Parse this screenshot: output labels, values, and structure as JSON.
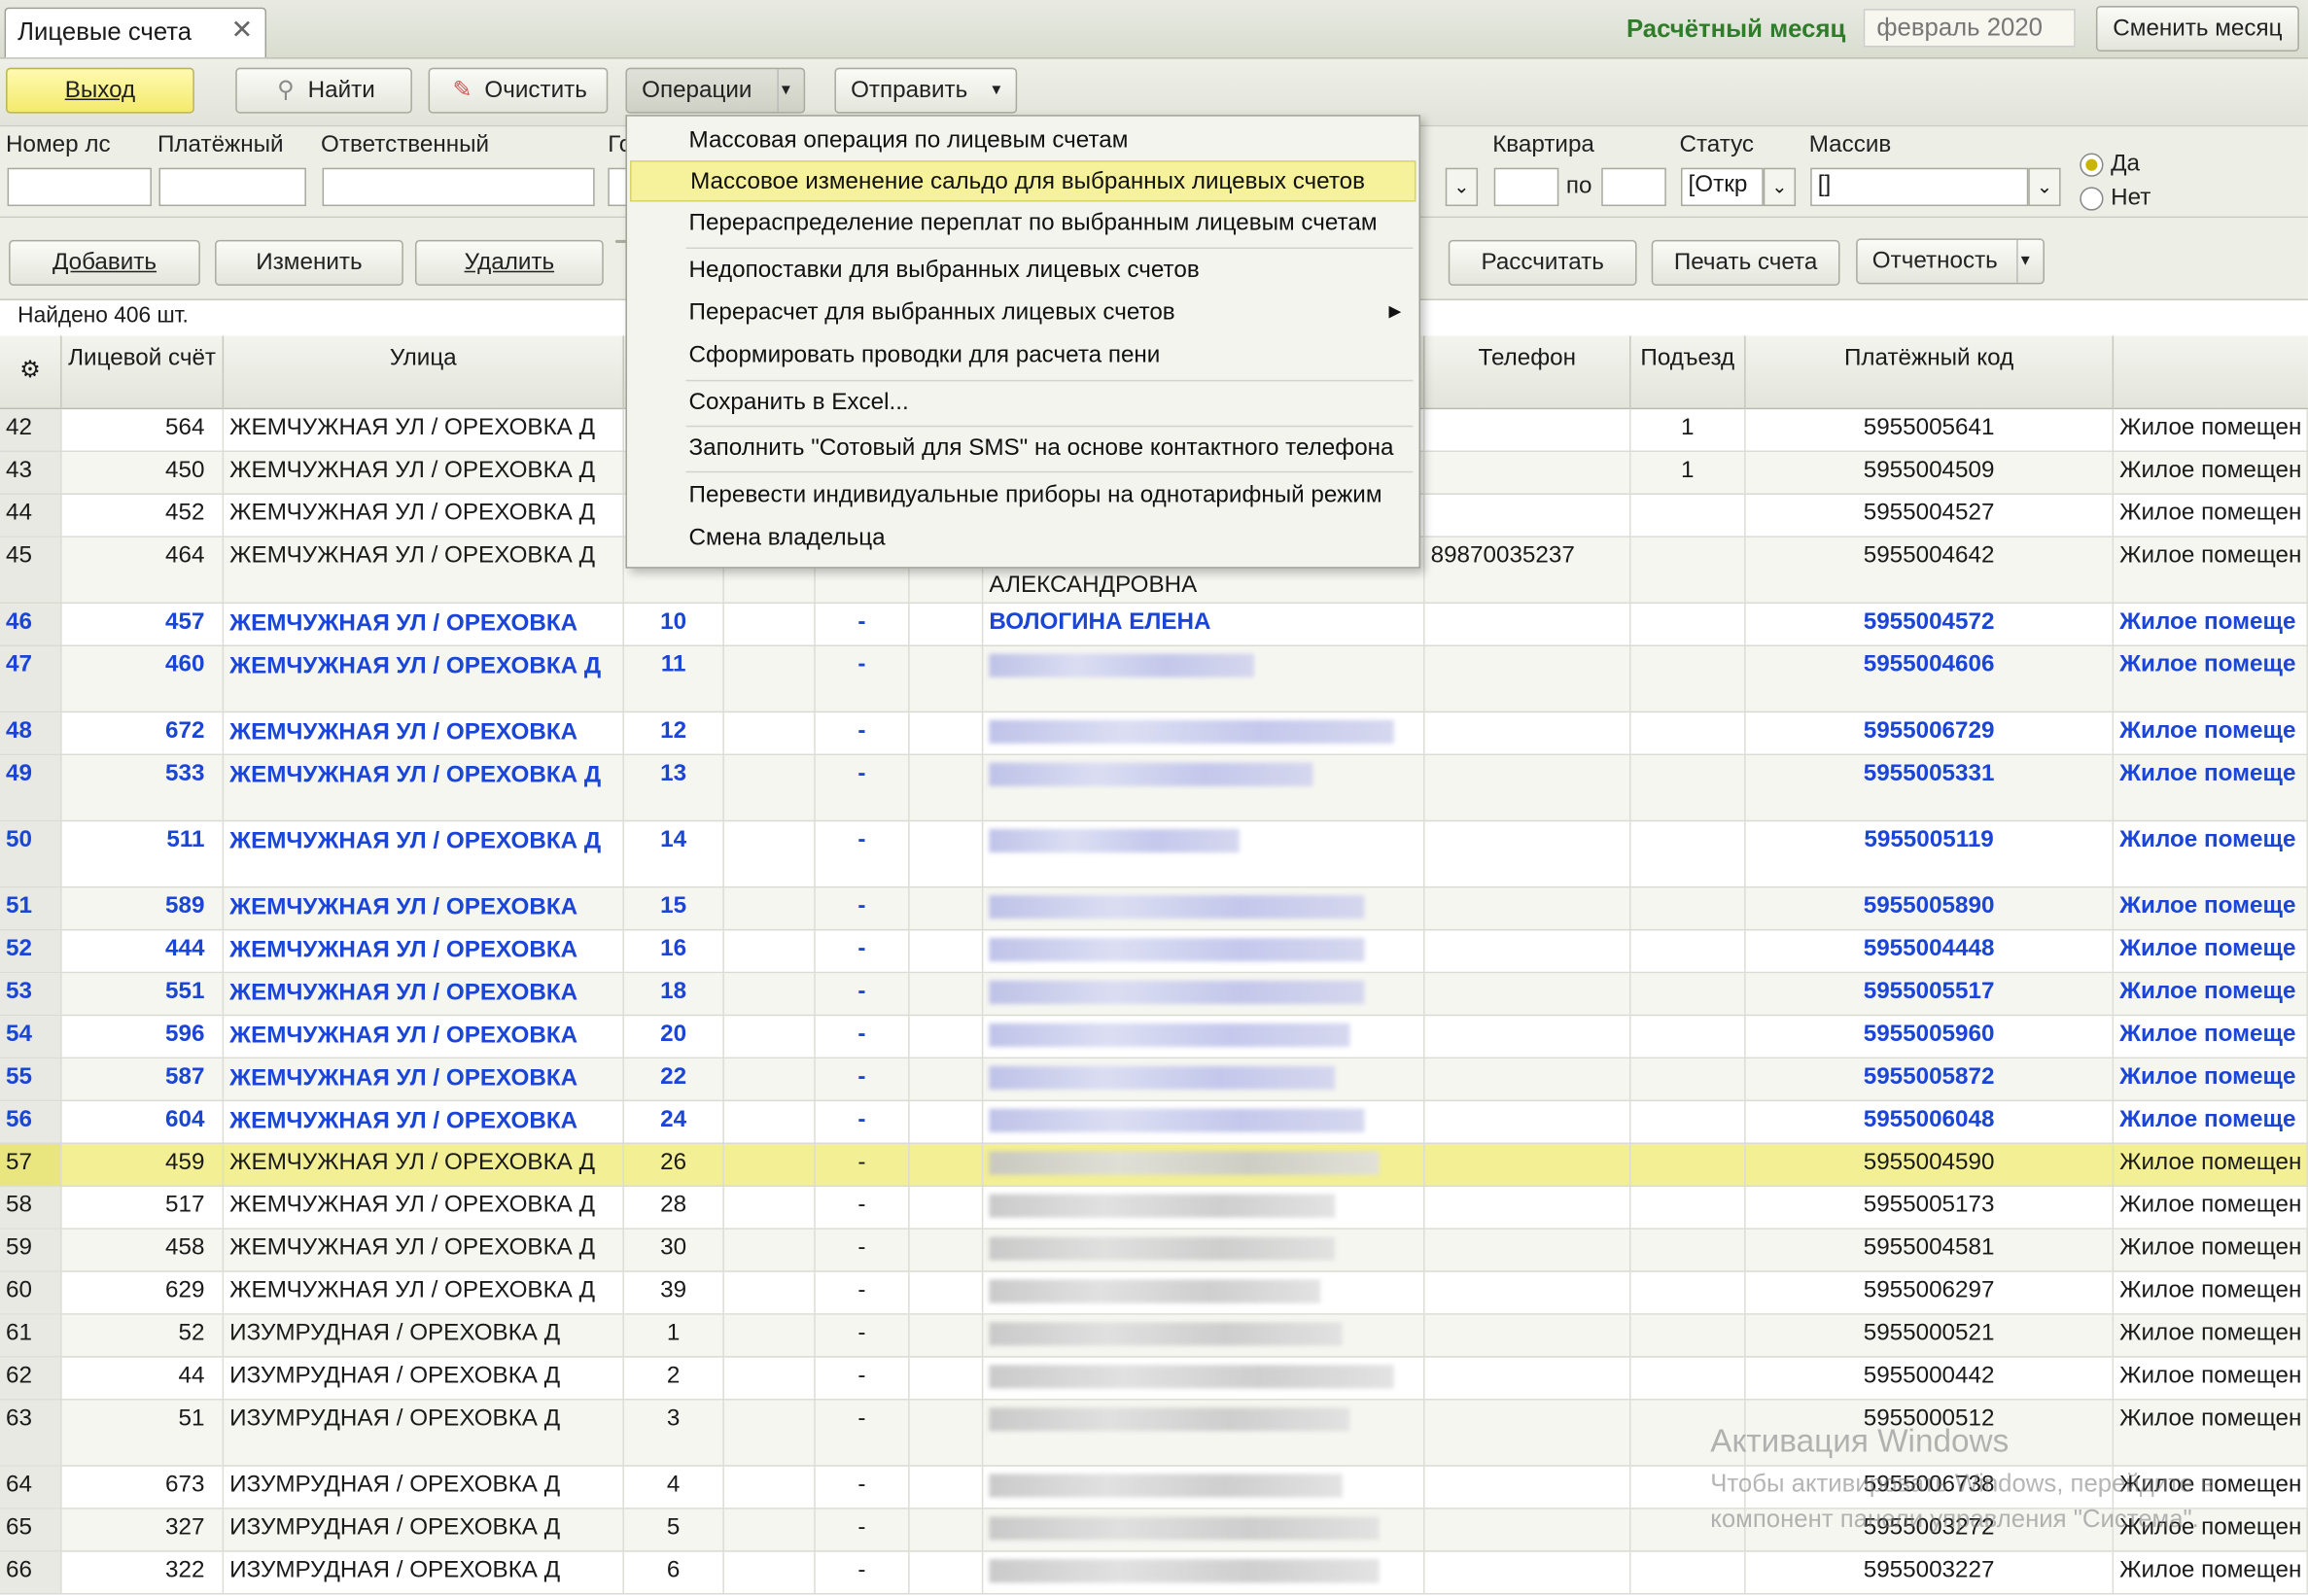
{
  "window": {
    "tab_title": "Лицевые счета",
    "tab_close": "✕",
    "month_label": "Расчётный месяц",
    "month_value": "февраль 2020",
    "change_month": "Сменить месяц"
  },
  "toolbar": {
    "exit": "Выход",
    "find": "Найти",
    "clear": "Очистить",
    "operations": "Операции",
    "send": "Отправить"
  },
  "filters": {
    "account": "Номер лс",
    "payer": "Платёжный",
    "responsible": "Ответственный",
    "house_prefix": "Го",
    "flat": "Квартира",
    "flat_to": "по",
    "status": "Статус",
    "status_value": "[Откр",
    "array": "Массив",
    "array_value": "[]",
    "yes": "Да",
    "no": "Нет"
  },
  "actions": {
    "add": "Добавить",
    "edit": "Изменить",
    "delete": "Удалить",
    "calculate": "Рассчитать",
    "print": "Печать счета",
    "reports": "Отчетность"
  },
  "found": "Найдено 406 шт.",
  "columns": {
    "account": "Лицевой счёт",
    "street": "Улица",
    "phone": "Телефон",
    "entrance": "Подъезд",
    "pay_code": "Платёжный код"
  },
  "menu": [
    "Массовая операция по лицевым счетам",
    "Массовое изменение сальдо для выбранных лицевых счетов",
    "Перераспределение переплат по выбранным лицевым счетам",
    "Недопоставки для выбранных лицевых счетов",
    "Перерасчет для выбранных лицевых счетов",
    "Сформировать проводки для расчета пени",
    "Сохранить в Excel...",
    "Заполнить \"Сотовый для SMS\" на основе контактного телефона",
    "Перевести индивидуальные приборы на однотарифный режим",
    "Смена владельца"
  ],
  "rows": [
    {
      "idx": "42",
      "ls": "564",
      "street": "ЖЕМЧУЖНАЯ УЛ / ОРЕХОВКА Д",
      "house": "",
      "dash": "",
      "name": "",
      "phone": "",
      "pod": "1",
      "code": "5955005641",
      "type": "Жилое помещен"
    },
    {
      "idx": "43",
      "ls": "450",
      "street": "ЖЕМЧУЖНАЯ УЛ / ОРЕХОВКА Д",
      "house": "",
      "dash": "",
      "name": "",
      "phone": "",
      "pod": "1",
      "code": "5955004509",
      "type": "Жилое помещен"
    },
    {
      "idx": "44",
      "ls": "452",
      "street": "ЖЕМЧУЖНАЯ УЛ / ОРЕХОВКА Д",
      "house": "",
      "dash": "",
      "name": "",
      "phone": "",
      "pod": "",
      "code": "5955004527",
      "type": "Жилое помещен"
    },
    {
      "idx": "45",
      "ls": "464",
      "street": "ЖЕМЧУЖНАЯ УЛ / ОРЕХОВКА Д",
      "house": "",
      "dash": "",
      "name": "АЛЕКСАНДРОВНА",
      "phone": "89870035237",
      "pod": "",
      "code": "5955004642",
      "type": "Жилое помещен"
    },
    {
      "idx": "46",
      "ls": "457",
      "street": "ЖЕМЧУЖНАЯ УЛ / ОРЕХОВКА",
      "house": "10",
      "dash": "-",
      "name": "ВОЛОГИНА ЕЛЕНА",
      "phone": "",
      "pod": "",
      "code": "5955004572",
      "type": "Жилое помеще"
    },
    {
      "idx": "47",
      "ls": "460",
      "street": "ЖЕМЧУЖНАЯ УЛ / ОРЕХОВКА Д",
      "house": "11",
      "dash": "-",
      "name": "",
      "phone": "",
      "pod": "",
      "code": "5955004606",
      "type": "Жилое помеще"
    },
    {
      "idx": "48",
      "ls": "672",
      "street": "ЖЕМЧУЖНАЯ УЛ / ОРЕХОВКА",
      "house": "12",
      "dash": "-",
      "name": "",
      "phone": "",
      "pod": "",
      "code": "5955006729",
      "type": "Жилое помеще"
    },
    {
      "idx": "49",
      "ls": "533",
      "street": "ЖЕМЧУЖНАЯ УЛ / ОРЕХОВКА Д",
      "house": "13",
      "dash": "-",
      "name": "",
      "phone": "",
      "pod": "",
      "code": "5955005331",
      "type": "Жилое помеще"
    },
    {
      "idx": "50",
      "ls": "511",
      "street": "ЖЕМЧУЖНАЯ УЛ / ОРЕХОВКА Д",
      "house": "14",
      "dash": "-",
      "name": "",
      "phone": "",
      "pod": "",
      "code": "5955005119",
      "type": "Жилое помеще"
    },
    {
      "idx": "51",
      "ls": "589",
      "street": "ЖЕМЧУЖНАЯ УЛ / ОРЕХОВКА",
      "house": "15",
      "dash": "-",
      "name": "",
      "phone": "",
      "pod": "",
      "code": "5955005890",
      "type": "Жилое помеще"
    },
    {
      "idx": "52",
      "ls": "444",
      "street": "ЖЕМЧУЖНАЯ УЛ / ОРЕХОВКА",
      "house": "16",
      "dash": "-",
      "name": "",
      "phone": "",
      "pod": "",
      "code": "5955004448",
      "type": "Жилое помеще"
    },
    {
      "idx": "53",
      "ls": "551",
      "street": "ЖЕМЧУЖНАЯ УЛ / ОРЕХОВКА",
      "house": "18",
      "dash": "-",
      "name": "",
      "phone": "",
      "pod": "",
      "code": "5955005517",
      "type": "Жилое помеще"
    },
    {
      "idx": "54",
      "ls": "596",
      "street": "ЖЕМЧУЖНАЯ УЛ / ОРЕХОВКА",
      "house": "20",
      "dash": "-",
      "name": "",
      "phone": "",
      "pod": "",
      "code": "5955005960",
      "type": "Жилое помеще"
    },
    {
      "idx": "55",
      "ls": "587",
      "street": "ЖЕМЧУЖНАЯ УЛ / ОРЕХОВКА",
      "house": "22",
      "dash": "-",
      "name": "",
      "phone": "",
      "pod": "",
      "code": "5955005872",
      "type": "Жилое помеще"
    },
    {
      "idx": "56",
      "ls": "604",
      "street": "ЖЕМЧУЖНАЯ УЛ / ОРЕХОВКА",
      "house": "24",
      "dash": "-",
      "name": "",
      "phone": "",
      "pod": "",
      "code": "5955006048",
      "type": "Жилое помеще"
    },
    {
      "idx": "57",
      "ls": "459",
      "street": "ЖЕМЧУЖНАЯ УЛ / ОРЕХОВКА Д",
      "house": "26",
      "dash": "-",
      "name": "",
      "phone": "",
      "pod": "",
      "code": "5955004590",
      "type": "Жилое помещен"
    },
    {
      "idx": "58",
      "ls": "517",
      "street": "ЖЕМЧУЖНАЯ УЛ / ОРЕХОВКА Д",
      "house": "28",
      "dash": "-",
      "name": "",
      "phone": "",
      "pod": "",
      "code": "5955005173",
      "type": "Жилое помещен"
    },
    {
      "idx": "59",
      "ls": "458",
      "street": "ЖЕМЧУЖНАЯ УЛ / ОРЕХОВКА Д",
      "house": "30",
      "dash": "-",
      "name": "",
      "phone": "",
      "pod": "",
      "code": "5955004581",
      "type": "Жилое помещен"
    },
    {
      "idx": "60",
      "ls": "629",
      "street": "ЖЕМЧУЖНАЯ УЛ / ОРЕХОВКА Д",
      "house": "39",
      "dash": "-",
      "name": "",
      "phone": "",
      "pod": "",
      "code": "5955006297",
      "type": "Жилое помещен"
    },
    {
      "idx": "61",
      "ls": "52",
      "street": "ИЗУМРУДНАЯ / ОРЕХОВКА Д",
      "house": "1",
      "dash": "-",
      "name": "",
      "phone": "",
      "pod": "",
      "code": "5955000521",
      "type": "Жилое помещен"
    },
    {
      "idx": "62",
      "ls": "44",
      "street": "ИЗУМРУДНАЯ / ОРЕХОВКА Д",
      "house": "2",
      "dash": "-",
      "name": "",
      "phone": "",
      "pod": "",
      "code": "5955000442",
      "type": "Жилое помещен"
    },
    {
      "idx": "63",
      "ls": "51",
      "street": "ИЗУМРУДНАЯ / ОРЕХОВКА Д",
      "house": "3",
      "dash": "-",
      "name": "",
      "phone": "",
      "pod": "",
      "code": "5955000512",
      "type": "Жилое помещен"
    },
    {
      "idx": "64",
      "ls": "673",
      "street": "ИЗУМРУДНАЯ / ОРЕХОВКА Д",
      "house": "4",
      "dash": "-",
      "name": "",
      "phone": "",
      "pod": "",
      "code": "5955006738",
      "type": "Жилое помещен"
    },
    {
      "idx": "65",
      "ls": "327",
      "street": "ИЗУМРУДНАЯ / ОРЕХОВКА Д",
      "house": "5",
      "dash": "-",
      "name": "",
      "phone": "",
      "pod": "",
      "code": "5955003272",
      "type": "Жилое помещен"
    },
    {
      "idx": "66",
      "ls": "322",
      "street": "ИЗУМРУДНАЯ / ОРЕХОВКА Д",
      "house": "6",
      "dash": "-",
      "name": "",
      "phone": "",
      "pod": "",
      "code": "5955003227",
      "type": "Жилое помещен"
    }
  ],
  "watermark": {
    "line1": "Активация Windows",
    "line2": "Чтобы активировать Windows, перейдите в",
    "line3": "компонент панели управления \"Система\"."
  }
}
